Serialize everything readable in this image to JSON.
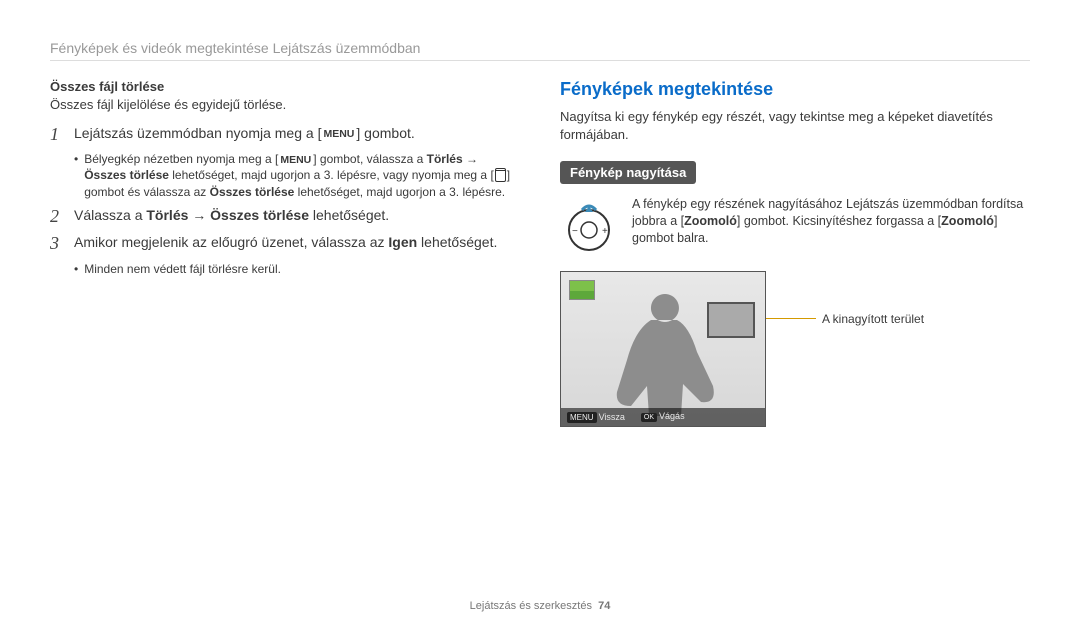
{
  "page_header": "Fényképek és videók megtekintése Lejátszás üzemmódban",
  "left": {
    "title": "Összes fájl törlése",
    "intro": "Összes fájl kijelölése és egyidejű törlése.",
    "step1_prefix": "Lejátszás üzemmódban nyomja meg a [",
    "step1_suffix": "] gombot.",
    "sub1_a": "Bélyegkép nézetben nyomja meg a [",
    "sub1_b": "] gombot, válassza a ",
    "sub1_torles": "Törlés",
    "sub1_arrow": " → ",
    "sub1_osszes": "Összes törlése",
    "sub1_c": " lehetőséget, majd ugorjon a 3. lépésre, vagy nyomja meg a [",
    "sub1_d": "] gombot és válassza az ",
    "sub1_osszes2": "Összes törlése",
    "sub1_e": " lehetőséget, majd ugorjon a 3. lépésre.",
    "step2_a": "Válassza a ",
    "step2_torles": "Törlés",
    "step2_arrow": " → ",
    "step2_osszes": "Összes törlése",
    "step2_b": " lehetőséget.",
    "step3_a": "Amikor megjelenik az előugró üzenet, válassza az ",
    "step3_igen": "Igen",
    "step3_b": " lehetőséget.",
    "sub3": "Minden nem védett fájl törlésre kerül.",
    "menu_label": "MENU"
  },
  "right": {
    "heading": "Fényképek megtekintése",
    "intro": "Nagyítsa ki egy fénykép egy részét, vagy tekintse meg a képeket diavetítés formájában.",
    "pill": "Fénykép nagyítása",
    "zoom_text_a": "A fénykép egy részének nagyításához Lejátszás üzemmódban fordítsa jobbra a [",
    "zoom_text_z1": "Zoomoló",
    "zoom_text_b": "] gombot. Kicsinyítéshez forgassa a [",
    "zoom_text_z2": "Zoomoló",
    "zoom_text_c": "] gombot balra.",
    "callout": "A kinagyított terület",
    "status_back_btn": "MENU",
    "status_back": "Vissza",
    "status_cut_btn": "OK",
    "status_cut": "Vágás"
  },
  "footer": {
    "section": "Lejátszás és szerkesztés",
    "page": "74"
  }
}
